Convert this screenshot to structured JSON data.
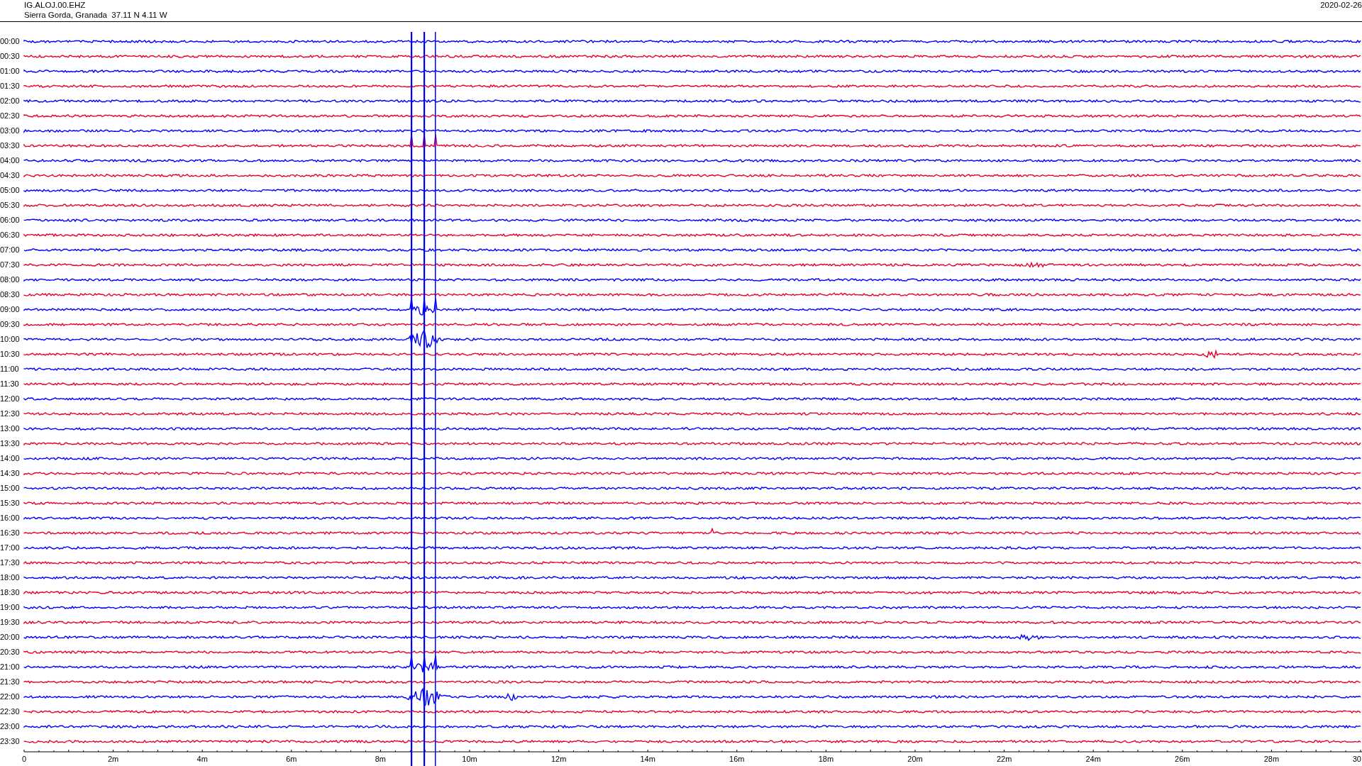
{
  "header": {
    "channel": "IG.ALOJ.00.EHZ",
    "location": "Sierra Gorda, Granada  37.11 N 4.11 W",
    "date": "2020-02-26"
  },
  "helicorder": {
    "rows": [
      {
        "time": "00:00",
        "color": "#0000ff"
      },
      {
        "time": "00:30",
        "color": "#e8002a"
      },
      {
        "time": "01:00",
        "color": "#0000ff"
      },
      {
        "time": "01:30",
        "color": "#e8002a"
      },
      {
        "time": "02:00",
        "color": "#0000ff"
      },
      {
        "time": "02:30",
        "color": "#e8002a"
      },
      {
        "time": "03:00",
        "color": "#0000ff"
      },
      {
        "time": "03:30",
        "color": "#e8002a"
      },
      {
        "time": "04:00",
        "color": "#0000ff"
      },
      {
        "time": "04:30",
        "color": "#e8002a"
      },
      {
        "time": "05:00",
        "color": "#0000ff"
      },
      {
        "time": "05:30",
        "color": "#e8002a"
      },
      {
        "time": "06:00",
        "color": "#0000ff"
      },
      {
        "time": "06:30",
        "color": "#e8002a"
      },
      {
        "time": "07:00",
        "color": "#0000ff"
      },
      {
        "time": "07:30",
        "color": "#e8002a"
      },
      {
        "time": "08:00",
        "color": "#0000ff"
      },
      {
        "time": "08:30",
        "color": "#e8002a"
      },
      {
        "time": "09:00",
        "color": "#0000ff"
      },
      {
        "time": "09:30",
        "color": "#e8002a"
      },
      {
        "time": "10:00",
        "color": "#0000ff"
      },
      {
        "time": "10:30",
        "color": "#e8002a"
      },
      {
        "time": "11:00",
        "color": "#0000ff"
      },
      {
        "time": "11:30",
        "color": "#e8002a"
      },
      {
        "time": "12:00",
        "color": "#0000ff"
      },
      {
        "time": "12:30",
        "color": "#e8002a"
      },
      {
        "time": "13:00",
        "color": "#0000ff"
      },
      {
        "time": "13:30",
        "color": "#e8002a"
      },
      {
        "time": "14:00",
        "color": "#0000ff"
      },
      {
        "time": "14:30",
        "color": "#e8002a"
      },
      {
        "time": "15:00",
        "color": "#0000ff"
      },
      {
        "time": "15:30",
        "color": "#e8002a"
      },
      {
        "time": "16:00",
        "color": "#0000ff"
      },
      {
        "time": "16:30",
        "color": "#e8002a"
      },
      {
        "time": "17:00",
        "color": "#0000ff"
      },
      {
        "time": "17:30",
        "color": "#e8002a"
      },
      {
        "time": "18:00",
        "color": "#0000ff"
      },
      {
        "time": "18:30",
        "color": "#e8002a"
      },
      {
        "time": "19:00",
        "color": "#0000ff"
      },
      {
        "time": "19:30",
        "color": "#e8002a"
      },
      {
        "time": "20:00",
        "color": "#0000ff"
      },
      {
        "time": "20:30",
        "color": "#e8002a"
      },
      {
        "time": "21:00",
        "color": "#0000ff"
      },
      {
        "time": "21:30",
        "color": "#e8002a"
      },
      {
        "time": "22:00",
        "color": "#0000ff"
      },
      {
        "time": "22:30",
        "color": "#e8002a"
      },
      {
        "time": "23:00",
        "color": "#0000ff"
      },
      {
        "time": "23:30",
        "color": "#e8002a"
      }
    ],
    "x_axis": {
      "labels": [
        "0",
        "2m",
        "4m",
        "6m",
        "8m",
        "10m",
        "12m",
        "14m",
        "16m",
        "18m",
        "20m",
        "22m",
        "24m",
        "26m",
        "28m",
        "30"
      ]
    }
  }
}
